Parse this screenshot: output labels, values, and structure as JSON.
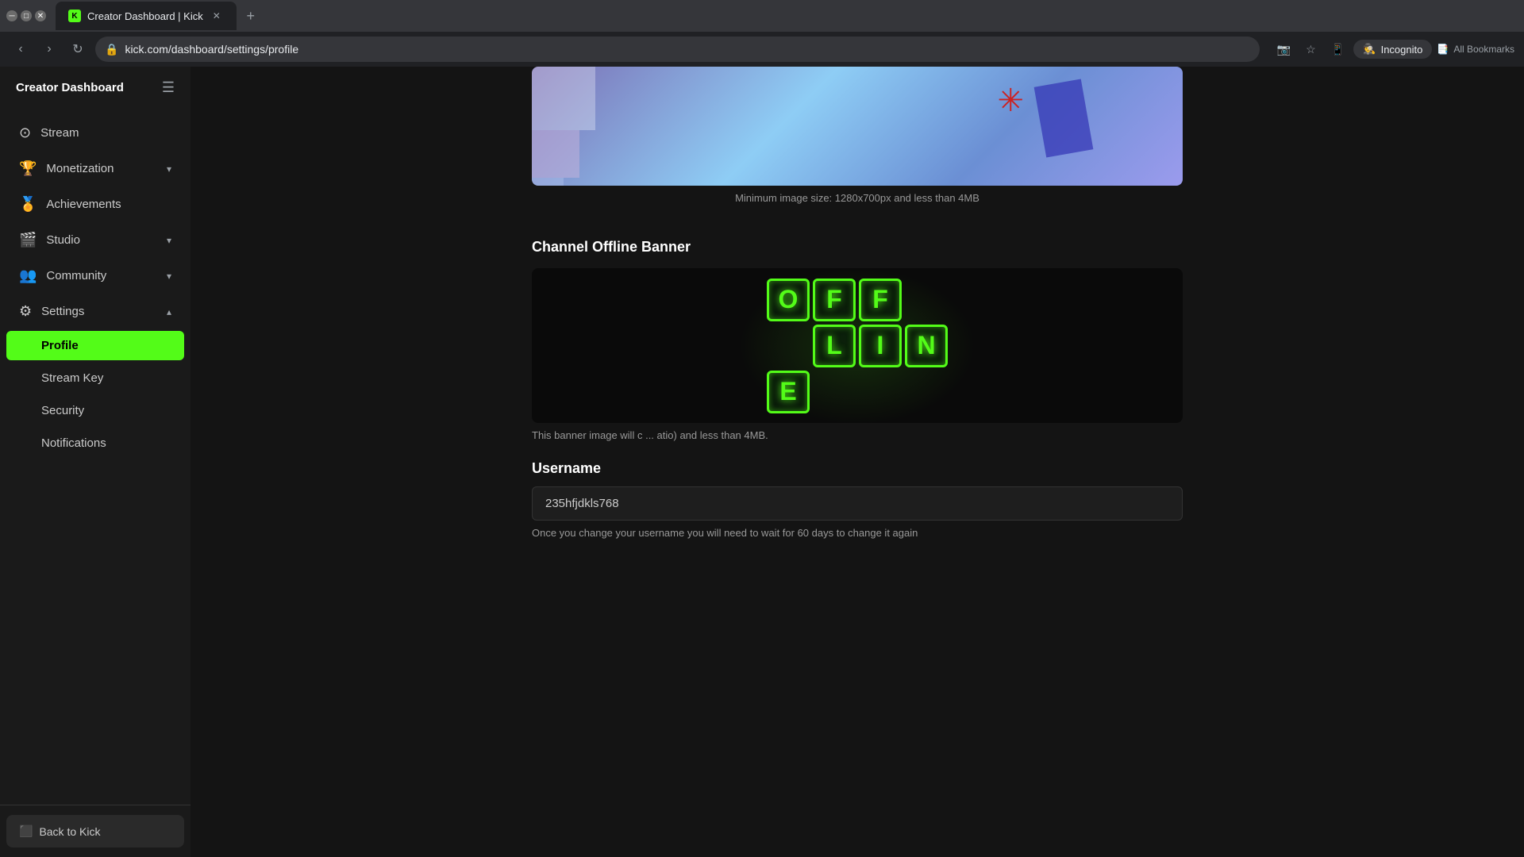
{
  "browser": {
    "tab_title": "Creator Dashboard | Kick",
    "tab_favicon": "K",
    "url": "kick.com/dashboard/settings/profile",
    "new_tab_label": "+",
    "incognito_label": "Incognito",
    "bookmarks_label": "All Bookmarks"
  },
  "sidebar": {
    "title": "Creator Dashboard",
    "nav_items": [
      {
        "id": "stream",
        "label": "Stream",
        "icon": "⊙"
      },
      {
        "id": "monetization",
        "label": "Monetization",
        "icon": "🏆",
        "expandable": true
      },
      {
        "id": "achievements",
        "label": "Achievements",
        "icon": "🏅"
      },
      {
        "id": "studio",
        "label": "Studio",
        "icon": "🎬",
        "expandable": true
      },
      {
        "id": "community",
        "label": "Community",
        "icon": "👥",
        "expandable": true
      }
    ],
    "settings": {
      "label": "Settings",
      "icon": "⚙",
      "expanded": true,
      "items": [
        {
          "id": "profile",
          "label": "Profile",
          "active": true
        },
        {
          "id": "stream-key",
          "label": "Stream Key"
        },
        {
          "id": "security",
          "label": "Security"
        },
        {
          "id": "notifications",
          "label": "Notifications"
        }
      ]
    },
    "back_button": "Back to Kick",
    "back_icon": "⬛"
  },
  "main": {
    "banner_hint": "Minimum image size: 1280x700px and less than 4MB",
    "offline_section_title": "Channel Offline Banner",
    "offline_letters": [
      "O",
      "F",
      "F",
      "",
      "L",
      "I",
      "N",
      "E"
    ],
    "offline_hint_left": "This banner image will c",
    "offline_hint_right": "atio) and less than 4MB.",
    "username_section_title": "Username",
    "username_value": "235hfjdkls768",
    "username_hint": "Once you change your username you will need to wait for 60 days to change it again"
  }
}
